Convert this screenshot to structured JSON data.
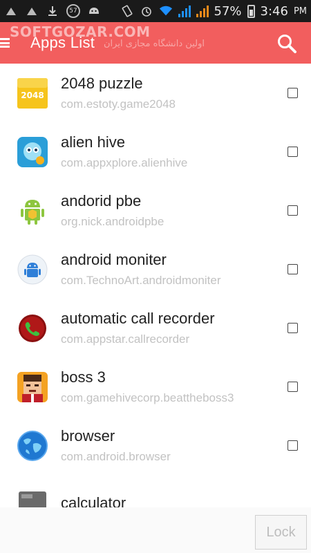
{
  "status_bar": {
    "left_icons": [
      "notification-icon",
      "notification-icon",
      "download-icon",
      "counter-badge-icon",
      "android-icon"
    ],
    "badge_count": "57",
    "right_icons": [
      "rotation-icon",
      "alarm-icon",
      "wifi-icon",
      "signal-icon",
      "signal-icon",
      "battery-icon"
    ],
    "battery": "57%",
    "time": "3:46",
    "ampm": "PM"
  },
  "app_bar": {
    "title": "Apps List",
    "watermark": "SOFTGOZAR.COM",
    "watermark_sub": "اولین دانشگاه مجازی ایران",
    "color": "#f25e5e"
  },
  "apps": [
    {
      "name": "2048 puzzle",
      "package": "com.estoty.game2048",
      "icon": "2048-icon",
      "icon_text": "2048"
    },
    {
      "name": "alien hive",
      "package": "com.appxplore.alienhive",
      "icon": "alien-hive-icon"
    },
    {
      "name": "andorid pbe",
      "package": "org.nick.androidpbe",
      "icon": "android-robot-icon"
    },
    {
      "name": "android moniter",
      "package": "com.TechnoArt.androidmoniter",
      "icon": "android-monitor-icon"
    },
    {
      "name": "automatic call recorder",
      "package": "com.appstar.callrecorder",
      "icon": "call-recorder-icon"
    },
    {
      "name": "boss 3",
      "package": "com.gamehivecorp.beattheboss3",
      "icon": "boss-icon"
    },
    {
      "name": "browser",
      "package": "com.android.browser",
      "icon": "globe-icon"
    },
    {
      "name": "calculator",
      "package": "",
      "icon": "calculator-icon"
    }
  ],
  "bottom": {
    "lock_label": "Lock"
  }
}
